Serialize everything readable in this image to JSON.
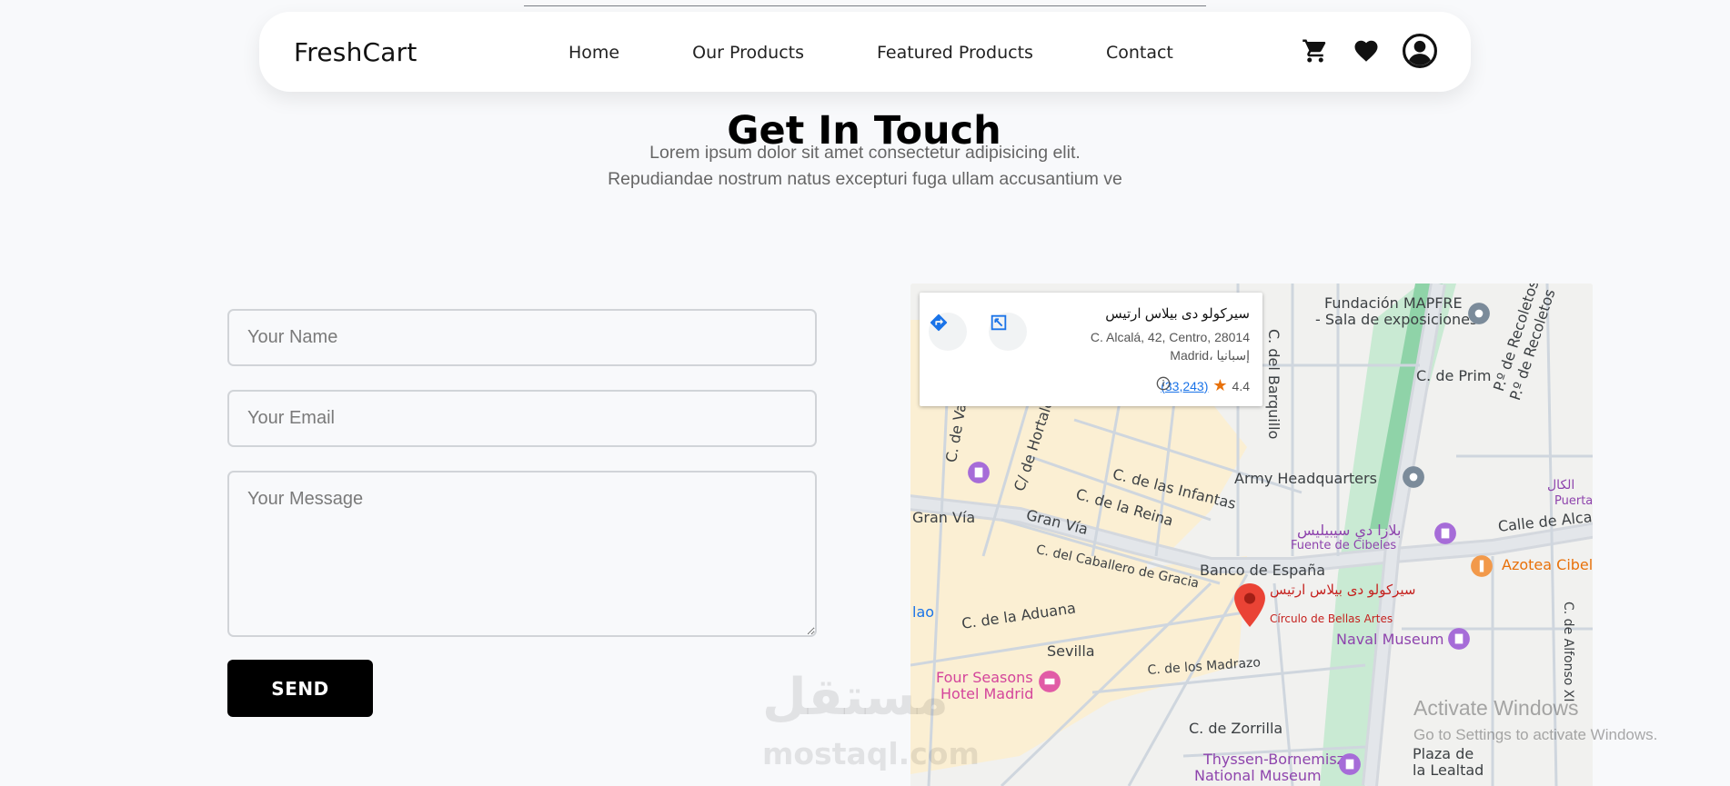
{
  "navbar": {
    "brand": "FreshCart",
    "links": [
      "Home",
      "Our Products",
      "Featured Products",
      "Contact"
    ],
    "icons": [
      "cart-icon",
      "heart-icon",
      "user-icon"
    ]
  },
  "contact": {
    "title": "Get In Touch",
    "subtitle_line1": "Lorem ipsum dolor sit amet consectetur adipisicing elit.",
    "subtitle_line2": "Repudiandae nostrum natus excepturi fuga ullam accusantium ve",
    "name_placeholder": "Your Name",
    "email_placeholder": "Your Email",
    "message_placeholder": "Your Message",
    "send_label": "SEND"
  },
  "map": {
    "place_name": "سيركولو دى بيلاس ارتيس",
    "address_line1": "C. Alcalá, 42, Centro, 28014",
    "address_line2": "Madrid، إسبانيا",
    "rating": "4.4",
    "reviews": "(33,243)",
    "labels": {
      "fundacion": "Fundación MAPFRE",
      "sala": "- Sala de exposiciones",
      "prim": "C. de Prim",
      "barquillo": "C. del Barquillo",
      "recoletos1": "P.º de Recoletos",
      "recoletos2": "P.º de Recoletos",
      "hortaleza": "C/ de Hortaleza",
      "valverde": "C. de Va",
      "infantas": "C. de las Infantas",
      "reina": "C. de la Reina",
      "army": "Army Headquarters",
      "granvia1": "Gran Vía",
      "granvia2": "Gran Vía",
      "caballero": "C. del Caballero de Gracia",
      "cibeles_ar": "بلازا دي سيبيليس",
      "cibeles": "Fuente de Cibeles",
      "alcala": "Calle de Alcalá",
      "azotea": "Azotea Cibele",
      "banco": "Banco de España",
      "circulo_ar": "سيركولو دى بيلاس ارتيس",
      "circulo": "Círculo de Bellas Artes",
      "aduana": "C. de la Aduana",
      "naval": "Naval Museum",
      "sevilla": "Sevilla",
      "madrazo": "C. de los Madrazo",
      "four1": "Four Seasons",
      "four2": "Hotel Madrid",
      "zorrilla": "C. de Zorrilla",
      "thyssen1": "Thyssen-Bornemisza",
      "thyssen2": "National Museum",
      "plaza1": "Plaza de",
      "plaza2": "la Lealtad",
      "alfonso": "C. de Alfonso XI",
      "puerta": "Puerta",
      "kal": "الكال",
      "lao": "lao"
    }
  },
  "watermark": {
    "arabic": "مستقل",
    "latin": "mostaql.com"
  },
  "os_notice": {
    "title": "Activate Windows",
    "subtitle": "Go to Settings to activate Windows."
  }
}
